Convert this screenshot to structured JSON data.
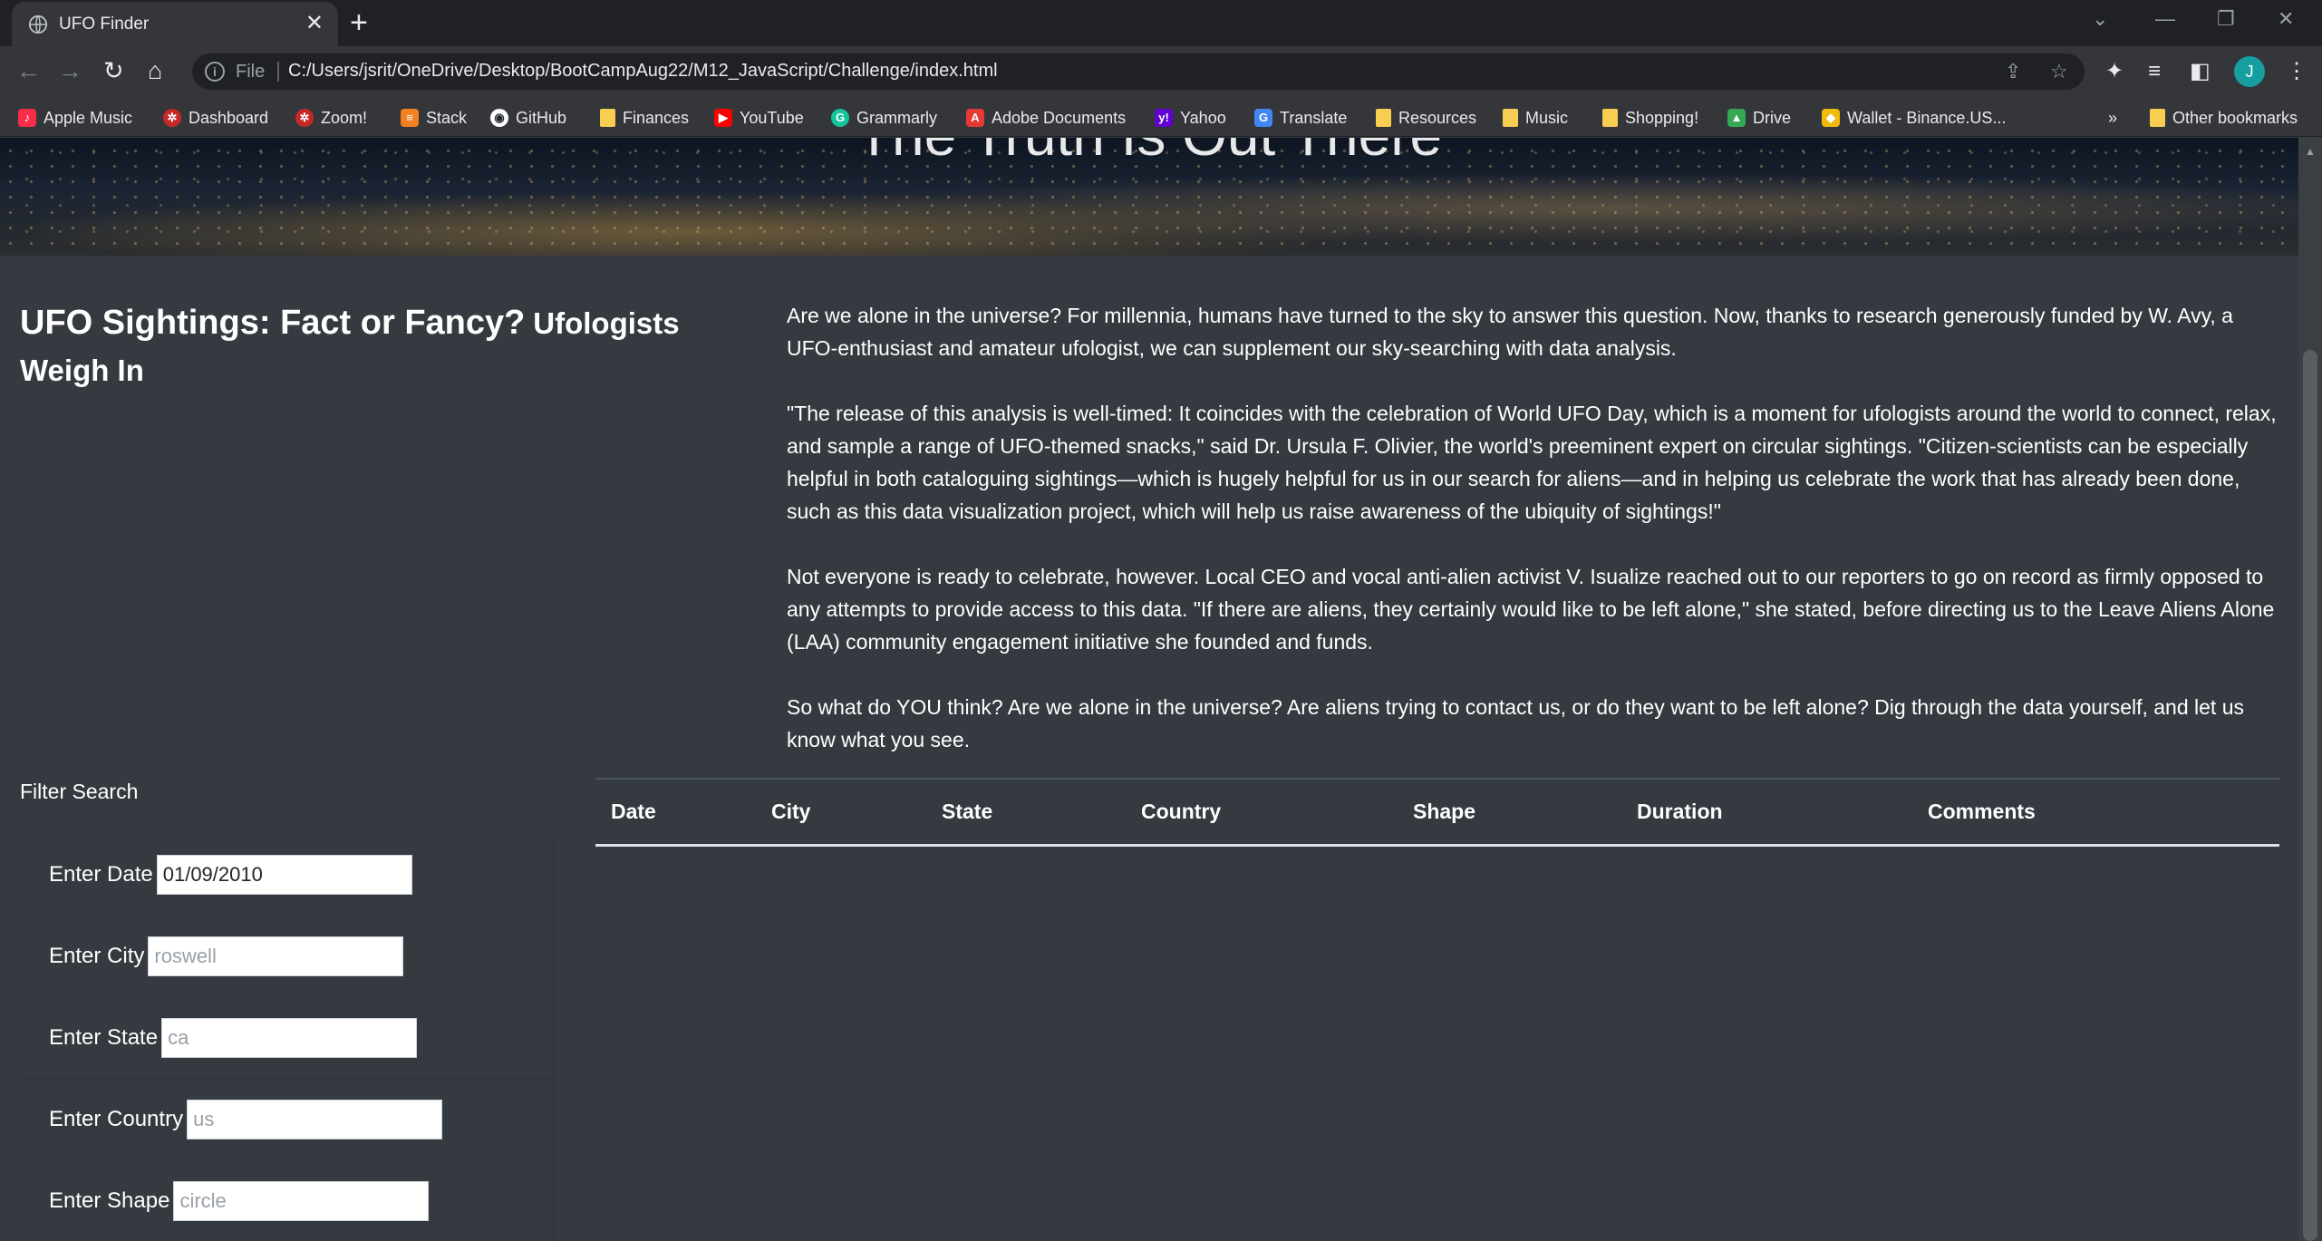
{
  "browser": {
    "tab": {
      "title": "UFO Finder",
      "favicon": "globe-icon",
      "close": "✕"
    },
    "new_tab": "+",
    "address": {
      "scheme": "File",
      "url": "C:/Users/jsrit/OneDrive/Desktop/BootCampAug22/M12_JavaScript/Challenge/index.html"
    },
    "avatar_initial": "J",
    "bookmarks": [
      {
        "label": "Apple Music",
        "icon": "apple-music-icon",
        "color": "#fa2d48"
      },
      {
        "label": "Dashboard",
        "icon": "dashboard-icon",
        "color": "#c62828"
      },
      {
        "label": "Zoom!",
        "icon": "zoom-icon",
        "color": "#c62828"
      },
      {
        "label": "Stack",
        "icon": "stack-icon",
        "color": "#f48024"
      },
      {
        "label": "GitHub",
        "icon": "github-icon",
        "color": "#ffffff"
      },
      {
        "label": "Finances",
        "icon": "folder-icon",
        "color": "#f7cd52"
      },
      {
        "label": "YouTube",
        "icon": "youtube-icon",
        "color": "#ff0000"
      },
      {
        "label": "Grammarly",
        "icon": "grammarly-icon",
        "color": "#15c39a"
      },
      {
        "label": "Adobe Documents",
        "icon": "adobe-icon",
        "color": "#e53935"
      },
      {
        "label": "Yahoo",
        "icon": "yahoo-icon",
        "color": "#6001d2"
      },
      {
        "label": "Translate",
        "icon": "translate-icon",
        "color": "#4285f4"
      },
      {
        "label": "Resources",
        "icon": "folder-icon",
        "color": "#f7cd52"
      },
      {
        "label": "Music",
        "icon": "folder-icon",
        "color": "#f7cd52"
      },
      {
        "label": "Shopping!",
        "icon": "folder-icon",
        "color": "#f7cd52"
      },
      {
        "label": "Drive",
        "icon": "drive-icon",
        "color": "#34a853"
      },
      {
        "label": "Wallet - Binance.US...",
        "icon": "binance-icon",
        "color": "#f0b90b"
      }
    ],
    "overflow": "»",
    "other_bookmarks": "Other bookmarks"
  },
  "page": {
    "hero_heading": "The Truth Is Out There",
    "title_main": "UFO Sightings: Fact or Fancy?",
    "title_sub": "Ufologists Weigh In",
    "paragraphs": [
      "Are we alone in the universe? For millennia, humans have turned to the sky to answer this question. Now, thanks to research generously funded by W. Avy, a UFO-enthusiast and amateur ufologist, we can supplement our sky-searching with data analysis.",
      "\"The release of this analysis is well-timed: It coincides with the celebration of World UFO Day, which is a moment for ufologists around the world to connect, relax, and sample a range of UFO-themed snacks,\" said Dr. Ursula F. Olivier, the world's preeminent expert on circular sightings. \"Citizen-scientists can be especially helpful in both cataloguing sightings—which is hugely helpful for us in our search for aliens—and in helping us celebrate the work that has already been done, such as this data visualization project, which will help us raise awareness of the ubiquity of sightings!\"",
      "Not everyone is ready to celebrate, however. Local CEO and vocal anti-alien activist V. Isualize reached out to our reporters to go on record as firmly opposed to any attempts to provide access to this data. \"If there are aliens, they certainly would like to be left alone,\" she stated, before directing us to the Leave Aliens Alone (LAA) community engagement initiative she founded and funds.",
      "So what do YOU think? Are we alone in the universe? Are aliens trying to contact us, or do they want to be left alone? Dig through the data yourself, and let us know what you see."
    ],
    "filter": {
      "heading": "Filter Search",
      "fields": [
        {
          "label": "Enter Date",
          "value": "01/09/2010",
          "placeholder": ""
        },
        {
          "label": "Enter City",
          "value": "",
          "placeholder": "roswell"
        },
        {
          "label": "Enter State",
          "value": "",
          "placeholder": "ca"
        },
        {
          "label": "Enter Country",
          "value": "",
          "placeholder": "us"
        },
        {
          "label": "Enter Shape",
          "value": "",
          "placeholder": "circle"
        }
      ]
    },
    "table": {
      "columns": [
        "Date",
        "City",
        "State",
        "Country",
        "Shape",
        "Duration",
        "Comments"
      ],
      "rows": []
    }
  }
}
